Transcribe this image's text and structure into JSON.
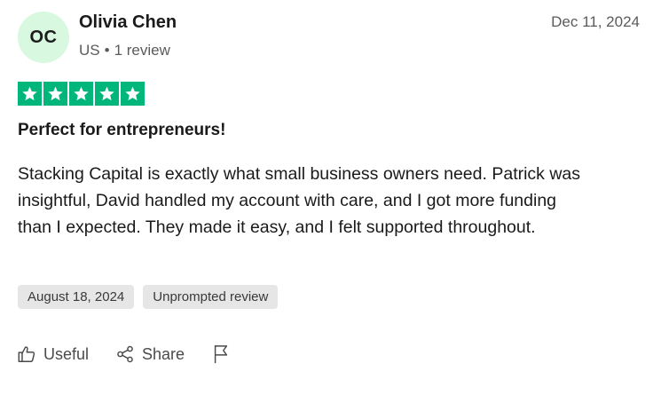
{
  "reviewer": {
    "initials": "OC",
    "name": "Olivia Chen",
    "country": "US",
    "separator": "•",
    "review_count": "1 review",
    "avatar_color": "#d8f8df"
  },
  "review": {
    "date": "Dec 11, 2024",
    "rating": 5,
    "star_color": "#00b67a",
    "title": "Perfect for entrepreneurs!",
    "body": "Stacking Capital is exactly what small business owners need. Patrick was insightful, David handled my account with care, and I got more funding than I expected. They made it easy, and I felt supported throughout.",
    "tags": [
      {
        "label": "August 18, 2024"
      },
      {
        "label": "Unprompted review"
      }
    ]
  },
  "actions": {
    "useful": {
      "label": "Useful",
      "icon": "thumbs-up-icon"
    },
    "share": {
      "label": "Share",
      "icon": "share-icon"
    },
    "report": {
      "icon": "flag-icon"
    }
  }
}
